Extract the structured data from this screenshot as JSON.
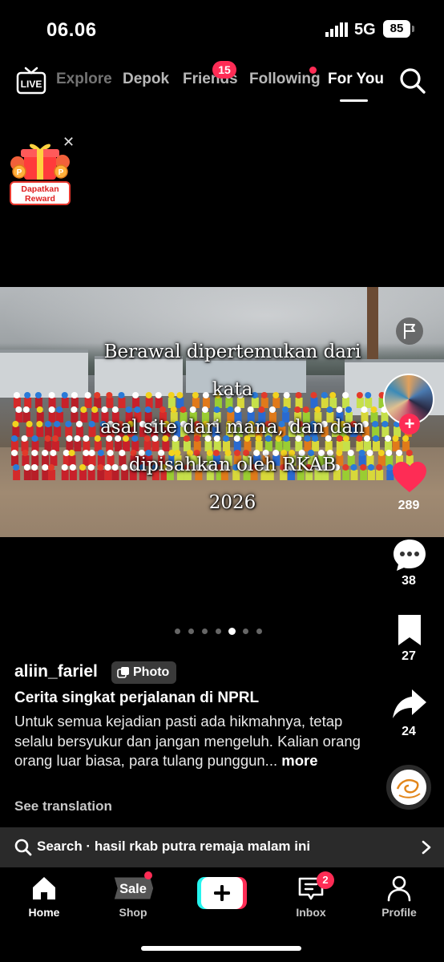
{
  "status_bar": {
    "time": "06.06",
    "network": "5G",
    "battery": "85"
  },
  "top_nav": {
    "live_icon": "live-tv-icon",
    "tabs": [
      {
        "label": "Explore"
      },
      {
        "label": "Depok"
      },
      {
        "label": "Friends",
        "badge": "15"
      },
      {
        "label": "Following",
        "has_dot": true
      },
      {
        "label": "For You",
        "active": true
      }
    ],
    "search_icon": "search-icon"
  },
  "reward_widget": {
    "label": "Dapatkan Reward",
    "close_icon": "close-icon"
  },
  "post": {
    "image_caption_lines": [
      "Berawal dipertemukan dari",
      "kata",
      "asal site dari mana, dan dan",
      "dipisahkan oleh RKAB",
      "2026"
    ],
    "carousel": {
      "total": 7,
      "active_index": 4
    },
    "username": "aliin_fariel",
    "type_badge": "Photo",
    "title": "Cerita singkat perjalanan di NPRL",
    "description": "Untuk semua kejadian pasti ada hikmahnya, tetap selalu bersyukur dan jangan mengeluh. Kalian orang orang luar biasa, para tulang punggun...",
    "more_label": "more",
    "see_translation": "See translation"
  },
  "actions": {
    "likes": "289",
    "comments": "38",
    "saves": "27",
    "shares": "24",
    "like_color": "#fe2c55"
  },
  "search_suggestion": {
    "prefix": "Search",
    "separator": " · ",
    "query": "hasil rkab putra remaja malam ini"
  },
  "bottom_nav": {
    "items": [
      {
        "label": "Home",
        "icon": "home-icon",
        "active": true
      },
      {
        "label": "Shop",
        "icon": "sale-tag-icon",
        "icon_text": "Sale",
        "has_dot": true
      },
      {
        "label": "",
        "icon": "create-plus-icon"
      },
      {
        "label": "Inbox",
        "icon": "inbox-icon",
        "badge": "2"
      },
      {
        "label": "Profile",
        "icon": "profile-icon"
      }
    ]
  },
  "colors": {
    "accent": "#fe2c55",
    "background": "#000000",
    "search_bar": "#2a2a2a"
  }
}
